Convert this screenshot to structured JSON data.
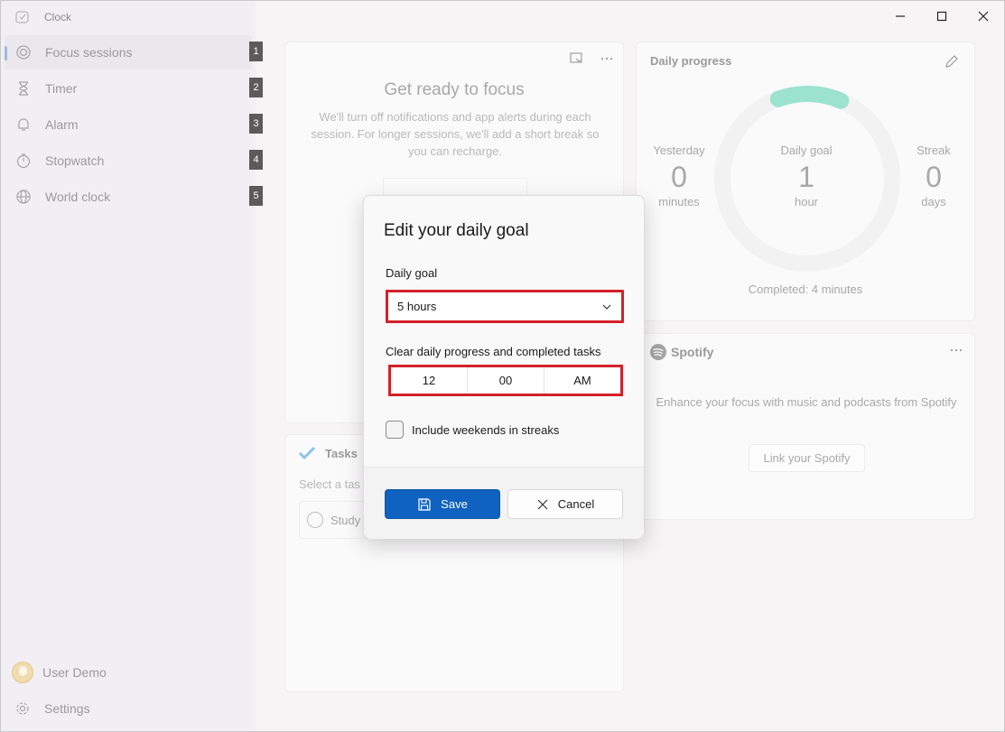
{
  "app": {
    "title": "Clock"
  },
  "sidebar": {
    "items": [
      {
        "label": "Focus sessions",
        "shortcut": "1",
        "icon": "focus-icon",
        "selected": true
      },
      {
        "label": "Timer",
        "shortcut": "2",
        "icon": "hourglass-icon"
      },
      {
        "label": "Alarm",
        "shortcut": "3",
        "icon": "bell-icon"
      },
      {
        "label": "Stopwatch",
        "shortcut": "4",
        "icon": "stopwatch-icon"
      },
      {
        "label": "World clock",
        "shortcut": "5",
        "icon": "globe-icon"
      }
    ],
    "user": "User Demo",
    "settings": "Settings"
  },
  "focus": {
    "title": "Get ready to focus",
    "description": "We'll turn off notifications and app alerts during each session. For longer sessions, we'll add a short break so you can recharge."
  },
  "tasks": {
    "title": "Tasks",
    "subtitle": "Select a tas",
    "task": "Study"
  },
  "progress": {
    "title": "Daily progress",
    "yesterday": {
      "label": "Yesterday",
      "value": "0",
      "unit": "minutes"
    },
    "goal": {
      "label": "Daily goal",
      "value": "1",
      "unit": "hour"
    },
    "streak": {
      "label": "Streak",
      "value": "0",
      "unit": "days"
    },
    "completed": "Completed: 4 minutes",
    "completed_fraction": 0.067,
    "accent": "#9be3cf"
  },
  "spotify": {
    "brand": "Spotify",
    "description": "Enhance your focus with music and podcasts from Spotify",
    "link": "Link your Spotify"
  },
  "dialog": {
    "title": "Edit your daily goal",
    "goal_label": "Daily goal",
    "goal_value": "5 hours",
    "clear_label": "Clear daily progress and completed tasks",
    "time": {
      "hour": "12",
      "minute": "00",
      "period": "AM"
    },
    "weekends_label": "Include weekends in streaks",
    "weekends_checked": false,
    "save": "Save",
    "cancel": "Cancel"
  },
  "colors": {
    "accent": "#0f62bf",
    "highlight": "#d4202a"
  }
}
